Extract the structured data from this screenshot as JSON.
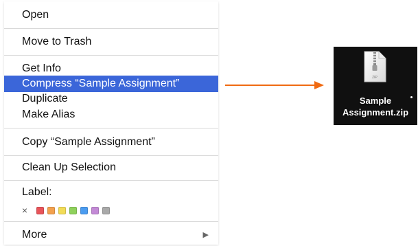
{
  "context_menu": {
    "items": [
      {
        "label": "Open"
      },
      {
        "label": "Move to Trash"
      },
      {
        "label": "Get Info"
      },
      {
        "label": "Compress “Sample Assignment”"
      },
      {
        "label": "Duplicate"
      },
      {
        "label": "Make Alias"
      },
      {
        "label": "Copy “Sample Assignment”"
      },
      {
        "label": "Clean Up Selection"
      },
      {
        "label": "Label:"
      },
      {
        "label": "More"
      }
    ],
    "label_clear_symbol": "×",
    "label_colors": [
      "#e8545a",
      "#f3a14e",
      "#f2dc58",
      "#8fd15c",
      "#4b9cf0",
      "#c38ad6",
      "#a9a9a9"
    ],
    "highlight_color": "#3b66d9",
    "more_arrow": "▶"
  },
  "arrow": {
    "color": "#f06a12"
  },
  "file": {
    "name_line1": "Sample",
    "name_line2": "Assignment.zip",
    "icon_badge": "ZIP",
    "icon_name": "zip-file-icon"
  }
}
